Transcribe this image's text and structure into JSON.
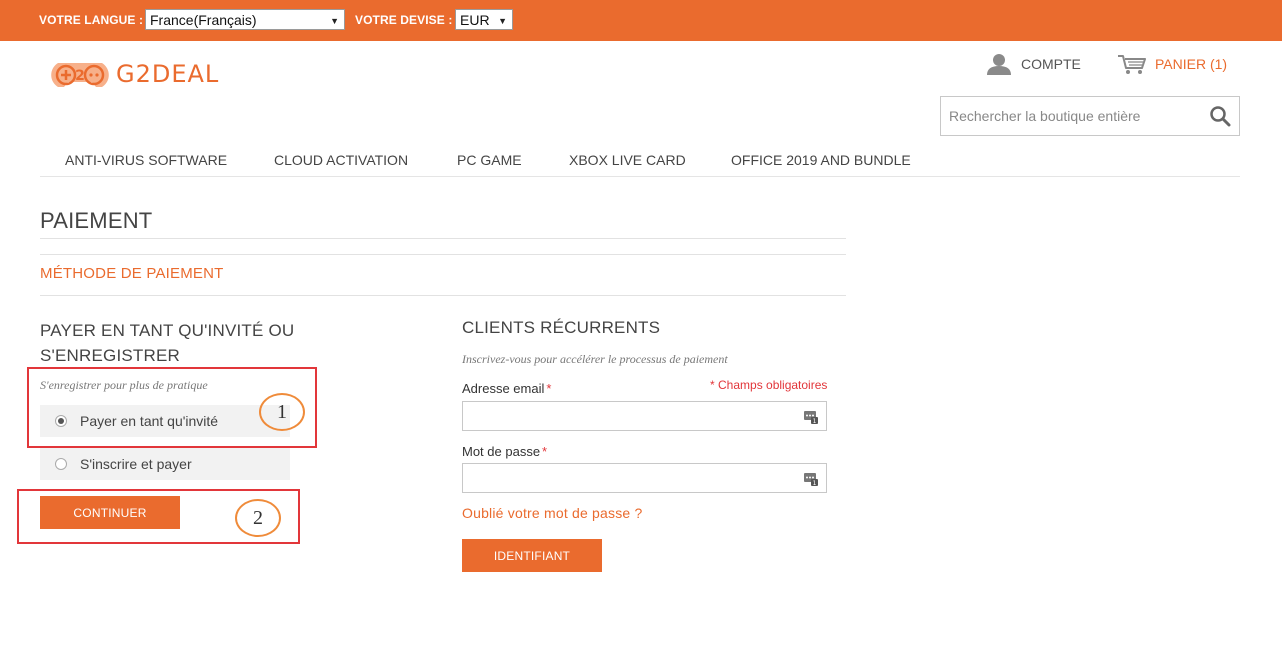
{
  "topbar": {
    "language_label": "VOTRE LANGUE :",
    "language_value": "France(Français)",
    "currency_label": "VOTRE DEVISE :",
    "currency_value": "EUR"
  },
  "header": {
    "logo_text": "G2DEAL",
    "account_label": "COMPTE",
    "cart_label": "PANIER (1)",
    "search_placeholder": "Rechercher la boutique entière"
  },
  "nav": {
    "items": [
      {
        "label": "ANTI-VIRUS SOFTWARE"
      },
      {
        "label": "CLOUD ACTIVATION"
      },
      {
        "label": "PC GAME"
      },
      {
        "label": "XBOX LIVE CARD"
      },
      {
        "label": "OFFICE 2019 AND BUNDLE"
      }
    ]
  },
  "main": {
    "page_title": "PAIEMENT",
    "step_title": "MÉTHODE DE PAIEMENT",
    "guest": {
      "title": "PAYER EN TANT QU'INVITÉ OU S'ENREGISTRER",
      "subtitle": "S'enregistrer pour plus de pratique",
      "options": [
        {
          "label": "Payer en tant qu'invité",
          "selected": true
        },
        {
          "label": "S'inscrire et payer",
          "selected": false
        }
      ],
      "continue_label": "CONTINUER"
    },
    "returning": {
      "title": "CLIENTS RÉCURRENTS",
      "subtitle": "Inscrivez-vous pour accélérer le processus de paiement",
      "required_note": "* Champs obligatoires",
      "email_label": "Adresse email",
      "email_value": "",
      "password_label": "Mot de passe",
      "password_value": "",
      "required_mark": "*",
      "forgot_label": "Oublié votre mot de passe ?",
      "login_label": "IDENTIFIANT"
    }
  },
  "annotations": {
    "marker_1": "1",
    "marker_2": "2"
  },
  "colors": {
    "brand": "#ea6b2e",
    "annotation_box": "#e2363a",
    "annotation_circle": "#ef8b3a"
  }
}
